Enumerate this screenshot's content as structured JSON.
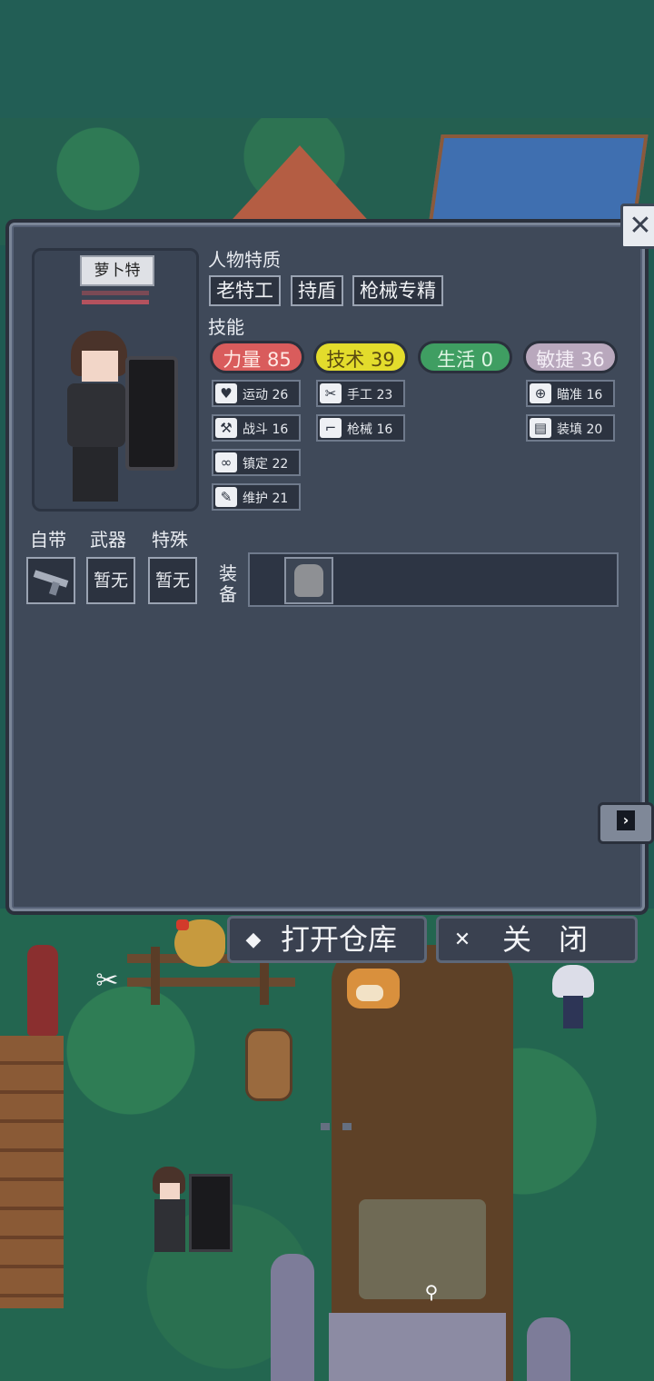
{
  "character": {
    "name": "萝卜特"
  },
  "sections": {
    "traits": "人物特质",
    "skills": "技能"
  },
  "traits": [
    "老特工",
    "持盾",
    "枪械专精"
  ],
  "stats": [
    {
      "label": "力量 85",
      "color": "#d95c5c"
    },
    {
      "label": "技术 39",
      "color": "#e3dc2c"
    },
    {
      "label": "生活 0",
      "color": "#3f9e62"
    },
    {
      "label": "敏捷 36",
      "color": "#b9a8bd"
    }
  ],
  "skills": {
    "col1": [
      {
        "icon": "heart-icon",
        "label": "运动 26"
      },
      {
        "icon": "axe-icon",
        "label": "战斗 16"
      },
      {
        "icon": "glasses-icon",
        "label": "镇定 22"
      },
      {
        "icon": "wrench-icon",
        "label": "维护 21"
      }
    ],
    "col2": [
      {
        "icon": "scissors-icon",
        "label": "手工 23"
      },
      {
        "icon": "gun-icon",
        "label": "枪械 16"
      }
    ],
    "col3": [
      {
        "icon": "crosshair-icon",
        "label": "瞄准 16"
      },
      {
        "icon": "magazine-icon",
        "label": "装填 20"
      }
    ]
  },
  "slots": {
    "labels": [
      "自带",
      "武器",
      "特殊"
    ],
    "weapon_value": "暂无",
    "special_value": "暂无",
    "equipment_label": "装备"
  },
  "buttons": {
    "open_storage": "打开仓库",
    "close": "关闭"
  },
  "colors": {
    "panel": "#3f4959",
    "panel_border": "#7b8698"
  }
}
